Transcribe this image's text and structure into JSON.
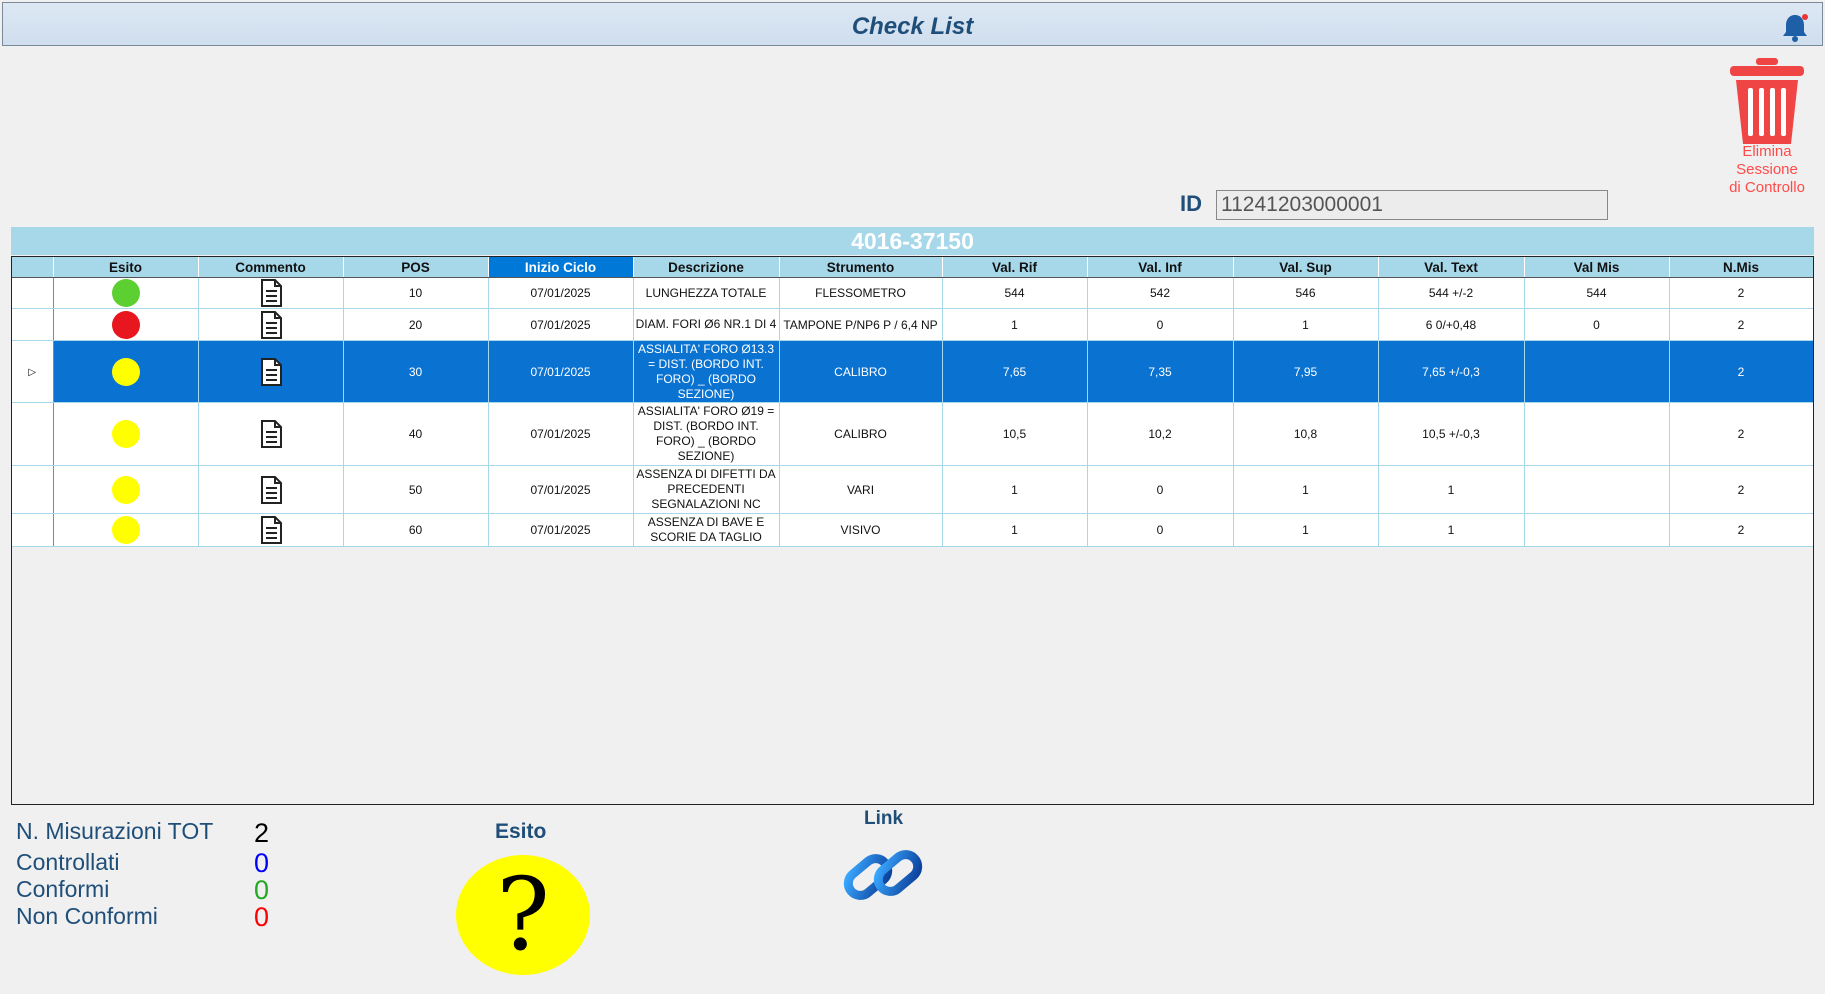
{
  "window": {
    "title": "Check List"
  },
  "toolbar": {
    "delete_label_1": "Elimina",
    "delete_label_2": "Sessione",
    "delete_label_3": "di Controllo"
  },
  "id_field": {
    "label": "ID",
    "value": "11241203000001"
  },
  "code": "4016-37150",
  "table": {
    "columns": [
      "Esito",
      "Commento",
      "POS",
      "Inizio Ciclo",
      "Descrizione",
      "Strumento",
      "Val. Rif",
      "Val. Inf",
      "Val. Sup",
      "Val. Text",
      "Val Mis",
      "N.Mis"
    ],
    "rows": [
      {
        "esito_color": "#5cd030",
        "pos": "10",
        "inizio": "07/01/2025",
        "descrizione": "LUNGHEZZA TOTALE",
        "strumento": "FLESSOMETRO",
        "rif": "544",
        "inf": "542",
        "sup": "546",
        "text": "544 +/-2",
        "mis": "544",
        "nmis": "2"
      },
      {
        "esito_color": "#e8161e",
        "pos": "20",
        "inizio": "07/01/2025",
        "descrizione": "DIAM. FORI Ø6 NR.1 DI 4",
        "strumento": "TAMPONE P/NP6 P / 6,4 NP",
        "rif": "1",
        "inf": "0",
        "sup": "1",
        "text": "6 0/+0,48",
        "mis": "0",
        "nmis": "2"
      },
      {
        "esito_color": "#ffff00",
        "pos": "30",
        "inizio": "07/01/2025",
        "descrizione": "ASSIALITA' FORO Ø13.3 = DIST. (BORDO INT. FORO) _ (BORDO SEZIONE)",
        "strumento": "CALIBRO",
        "rif": "7,65",
        "inf": "7,35",
        "sup": "7,95",
        "text": "7,65 +/-0,3",
        "mis": "",
        "nmis": "2"
      },
      {
        "esito_color": "#ffff00",
        "pos": "40",
        "inizio": "07/01/2025",
        "descrizione": "ASSIALITA' FORO Ø19 = DIST. (BORDO INT. FORO) _ (BORDO SEZIONE)",
        "strumento": "CALIBRO",
        "rif": "10,5",
        "inf": "10,2",
        "sup": "10,8",
        "text": "10,5 +/-0,3",
        "mis": "",
        "nmis": "2"
      },
      {
        "esito_color": "#ffff00",
        "pos": "50",
        "inizio": "07/01/2025",
        "descrizione": "ASSENZA DI DIFETTI DA PRECEDENTI SEGNALAZIONI NC",
        "strumento": "VARI",
        "rif": "1",
        "inf": "0",
        "sup": "1",
        "text": "1",
        "mis": "",
        "nmis": "2"
      },
      {
        "esito_color": "#ffff00",
        "pos": "60",
        "inizio": "07/01/2025",
        "descrizione": "ASSENZA DI BAVE E SCORIE DA TAGLIO",
        "strumento": "VISIVO",
        "rif": "1",
        "inf": "0",
        "sup": "1",
        "text": "1",
        "mis": "",
        "nmis": "2"
      }
    ]
  },
  "stats": {
    "tot_label": "N. Misurazioni TOT",
    "tot_value": "2",
    "tot_color": "#000000",
    "controllati_label": "Controllati",
    "controllati_value": "0",
    "controllati_color": "#0000ff",
    "conformi_label": "Conformi",
    "conformi_value": "0",
    "conformi_color": "#22aa22",
    "non_conformi_label": "Non Conformi",
    "non_conformi_value": "0",
    "non_conformi_color": "#ff0000"
  },
  "esito": {
    "label": "Esito",
    "symbol": "?",
    "color": "#ffff00"
  },
  "link": {
    "label": "Link"
  },
  "icons": {
    "bell": "bell-icon",
    "trash": "trash-icon",
    "comment": "document-icon",
    "link": "chain-link-icon"
  }
}
